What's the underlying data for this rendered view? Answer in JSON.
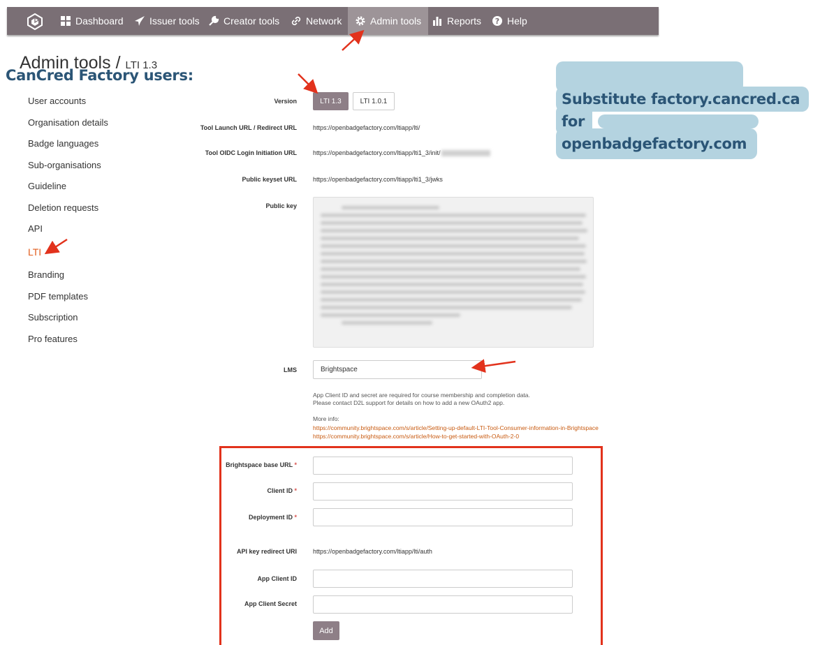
{
  "nav": {
    "items": [
      {
        "label": "Dashboard",
        "icon": "dashboard-icon"
      },
      {
        "label": "Issuer tools",
        "icon": "paper-plane-icon"
      },
      {
        "label": "Creator tools",
        "icon": "wrench-icon"
      },
      {
        "label": "Network",
        "icon": "link-icon"
      },
      {
        "label": "Admin tools",
        "icon": "gear-icon",
        "active": true
      },
      {
        "label": "Reports",
        "icon": "bar-chart-icon"
      },
      {
        "label": "Help",
        "icon": "question-circle-icon"
      }
    ]
  },
  "page": {
    "title": "Admin tools",
    "separator": " / ",
    "subtitle": "LTI 1.3"
  },
  "sidebar": {
    "items": [
      {
        "label": "User accounts"
      },
      {
        "label": "Organisation details"
      },
      {
        "label": "Badge languages"
      },
      {
        "label": "Sub-organisations"
      },
      {
        "label": "Guideline"
      },
      {
        "label": "Deletion requests"
      },
      {
        "label": "API"
      },
      {
        "label": "LTI",
        "active": true
      },
      {
        "label": "Branding"
      },
      {
        "label": "PDF templates"
      },
      {
        "label": "Subscription"
      },
      {
        "label": "Pro features"
      }
    ]
  },
  "form": {
    "version_label": "Version",
    "version_options": [
      "LTI 1.3",
      "LTI 1.0.1"
    ],
    "version_selected": "LTI 1.3",
    "launch_label": "Tool Launch URL / Redirect URL",
    "launch_value": "https://openbadgefactory.com/ltiapp/lti/",
    "oidc_label": "Tool OIDC Login Initiation URL",
    "oidc_value": "https://openbadgefactory.com/ltiapp/lti1_3/init/",
    "keyset_label": "Public keyset URL",
    "keyset_value": "https://openbadgefactory.com/ltiapp/lti1_3/jwks",
    "pubkey_label": "Public key",
    "lms_label": "LMS",
    "lms_value": "Brightspace",
    "help_line1": "App Client ID and secret are required for course membership and completion data.",
    "help_line2": "Please contact D2L support for details on how to add a new OAuth2 app.",
    "more_info": "More info:",
    "link1": "https://community.brightspace.com/s/article/Setting-up-default-LTI-Tool-Consumer-information-in-Brightspace",
    "link2": "https://community.brightspace.com/s/article/How-to-get-started-with-OAuth-2-0",
    "base_url_label": "Brightspace base URL",
    "client_id_label": "Client ID",
    "deployment_id_label": "Deployment ID",
    "required_mark": "*",
    "api_redirect_label": "API key redirect URI",
    "api_redirect_value": "https://openbadgefactory.com/ltiapp/lti/auth",
    "app_client_id_label": "App Client ID",
    "app_client_secret_label": "App Client Secret",
    "add_button": "Add"
  },
  "note": {
    "line1": "CanCred Factory users:",
    "line2": "Substitute factory.cancred.ca",
    "line3": "for",
    "line4": "openbadgefactory.com"
  },
  "colors": {
    "nav_bg": "#7a6f75",
    "nav_active": "#9d9498",
    "accent_orange": "#e25d1d",
    "button": "#8e7f87",
    "annotation_red": "#e2321c",
    "note_bg": "#b4d3e0",
    "note_text": "#2b5576"
  }
}
